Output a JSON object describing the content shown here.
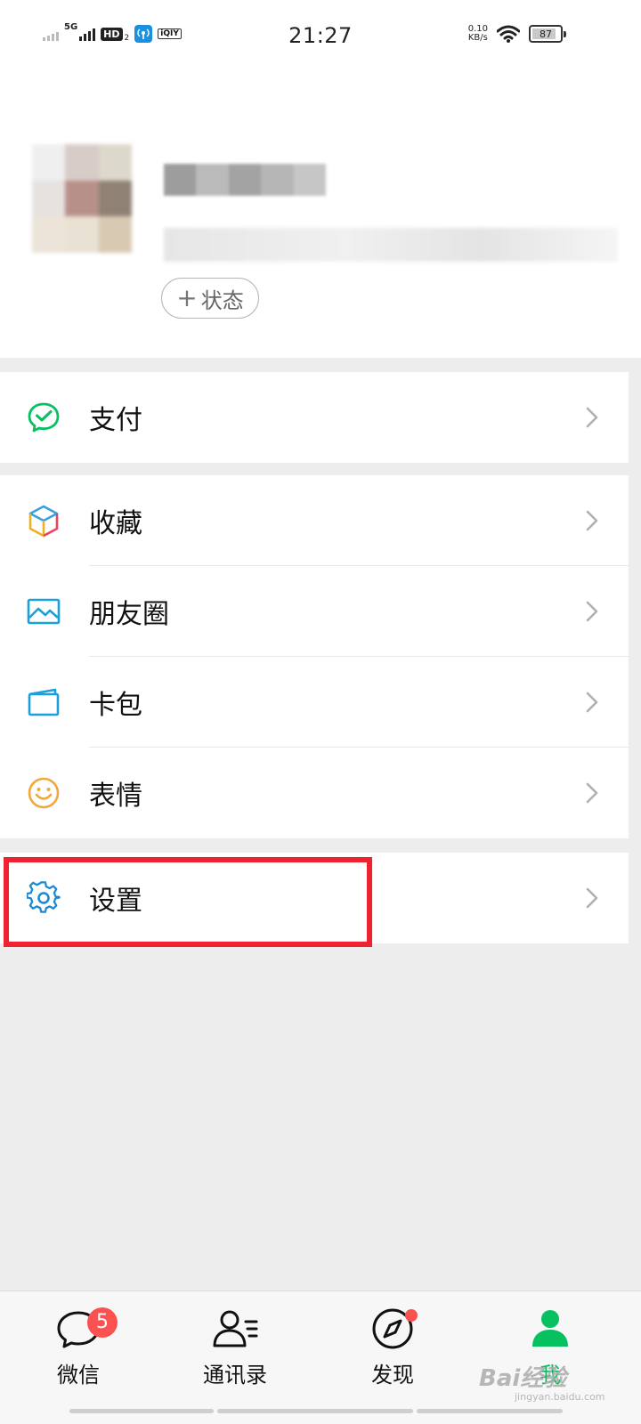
{
  "status_bar": {
    "network_type": "5G",
    "hd_label": "HD",
    "hd_sub": "2",
    "iqiyi_label": "iQIY",
    "time": "21:27",
    "speed_value": "0.10",
    "speed_unit": "KB/s",
    "battery": "87",
    "battery_level": 0.87
  },
  "profile": {
    "status_button_label": "状态",
    "status_button_plus": "+"
  },
  "menu": {
    "pay": {
      "label": "支付",
      "icon": "wechat-pay-icon",
      "color": "#07c160"
    },
    "favorites": {
      "label": "收藏",
      "icon": "cube-icon"
    },
    "moments": {
      "label": "朋友圈",
      "icon": "image-icon",
      "color": "#1aa0dc"
    },
    "cards": {
      "label": "卡包",
      "icon": "card-wallet-icon",
      "color": "#1aa0dc"
    },
    "stickers": {
      "label": "表情",
      "icon": "smile-icon",
      "color": "#f0a83c"
    },
    "settings": {
      "label": "设置",
      "icon": "gear-icon",
      "color": "#1a8ad6"
    }
  },
  "tabbar": {
    "chats": {
      "label": "微信",
      "badge": "5"
    },
    "contacts": {
      "label": "通讯录"
    },
    "discover": {
      "label": "发现"
    },
    "me": {
      "label": "我",
      "active_color": "#07c160"
    }
  },
  "watermark": {
    "text": "Bai经验",
    "sub": "jingyan.baidu.com"
  },
  "colors": {
    "highlight": "#f0222f",
    "badge": "#fa5151",
    "accent": "#07c160"
  }
}
